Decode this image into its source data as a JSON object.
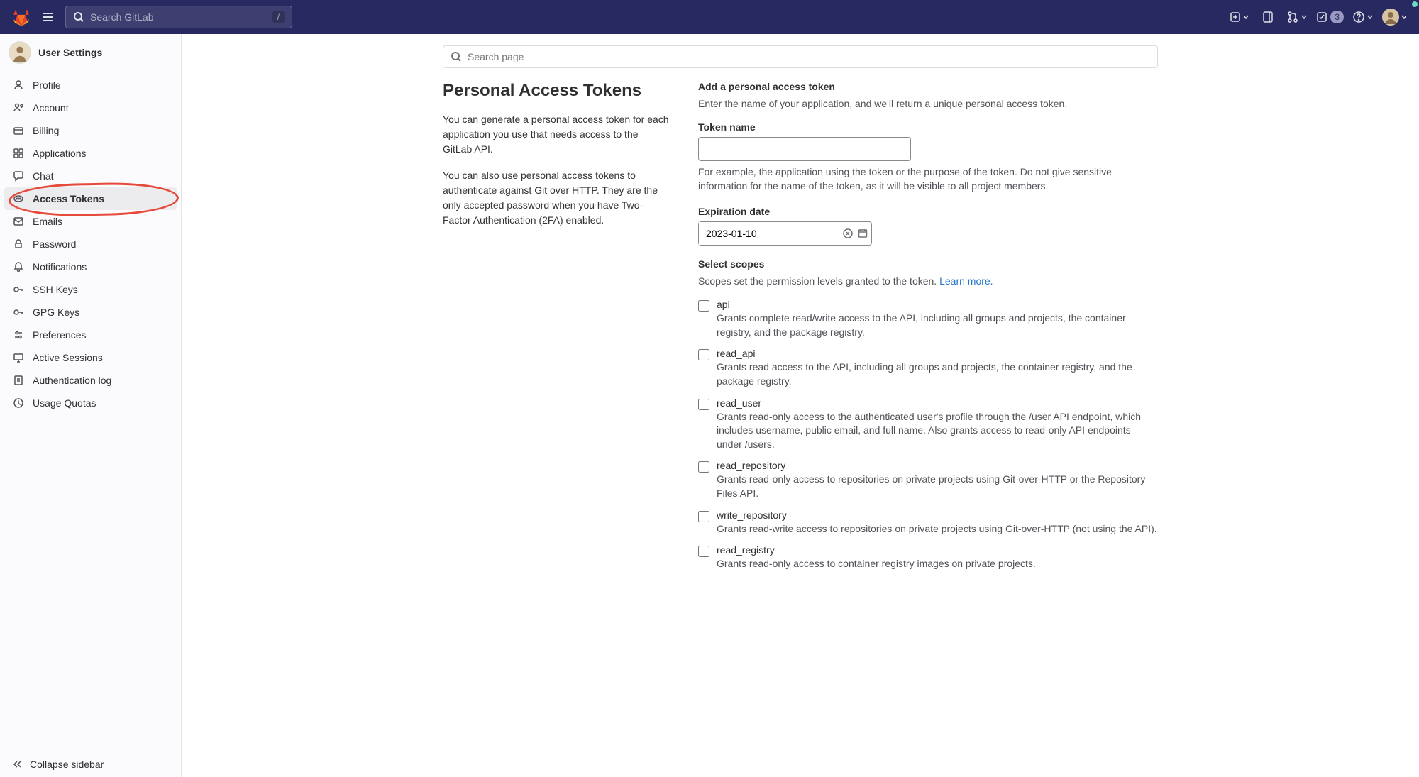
{
  "navbar": {
    "search_placeholder": "Search GitLab",
    "search_key": "/",
    "todo_count": "3"
  },
  "sidebar": {
    "title": "User Settings",
    "items": [
      {
        "label": "Profile"
      },
      {
        "label": "Account"
      },
      {
        "label": "Billing"
      },
      {
        "label": "Applications"
      },
      {
        "label": "Chat"
      },
      {
        "label": "Access Tokens"
      },
      {
        "label": "Emails"
      },
      {
        "label": "Password"
      },
      {
        "label": "Notifications"
      },
      {
        "label": "SSH Keys"
      },
      {
        "label": "GPG Keys"
      },
      {
        "label": "Preferences"
      },
      {
        "label": "Active Sessions"
      },
      {
        "label": "Authentication log"
      },
      {
        "label": "Usage Quotas"
      }
    ],
    "collapse": "Collapse sidebar"
  },
  "page_search_placeholder": "Search page",
  "left": {
    "heading": "Personal Access Tokens",
    "p1": "You can generate a personal access token for each application you use that needs access to the GitLab API.",
    "p2": "You can also use personal access tokens to authenticate against Git over HTTP. They are the only accepted password when you have Two-Factor Authentication (2FA) enabled."
  },
  "form": {
    "title": "Add a personal access token",
    "subtitle": "Enter the name of your application, and we'll return a unique personal access token.",
    "token_name_label": "Token name",
    "token_name_value": "",
    "token_name_help": "For example, the application using the token or the purpose of the token. Do not give sensitive information for the name of the token, as it will be visible to all project members.",
    "expiration_label": "Expiration date",
    "expiration_value": "2023-01-10",
    "scopes_label": "Select scopes",
    "scopes_help": "Scopes set the permission levels granted to the token. ",
    "learn_more": "Learn more.",
    "scopes": [
      {
        "name": "api",
        "desc": "Grants complete read/write access to the API, including all groups and projects, the container registry, and the package registry."
      },
      {
        "name": "read_api",
        "desc": "Grants read access to the API, including all groups and projects, the container registry, and the package registry."
      },
      {
        "name": "read_user",
        "desc": "Grants read-only access to the authenticated user's profile through the /user API endpoint, which includes username, public email, and full name. Also grants access to read-only API endpoints under /users."
      },
      {
        "name": "read_repository",
        "desc": "Grants read-only access to repositories on private projects using Git-over-HTTP or the Repository Files API."
      },
      {
        "name": "write_repository",
        "desc": "Grants read-write access to repositories on private projects using Git-over-HTTP (not using the API)."
      },
      {
        "name": "read_registry",
        "desc": "Grants read-only access to container registry images on private projects."
      }
    ]
  }
}
